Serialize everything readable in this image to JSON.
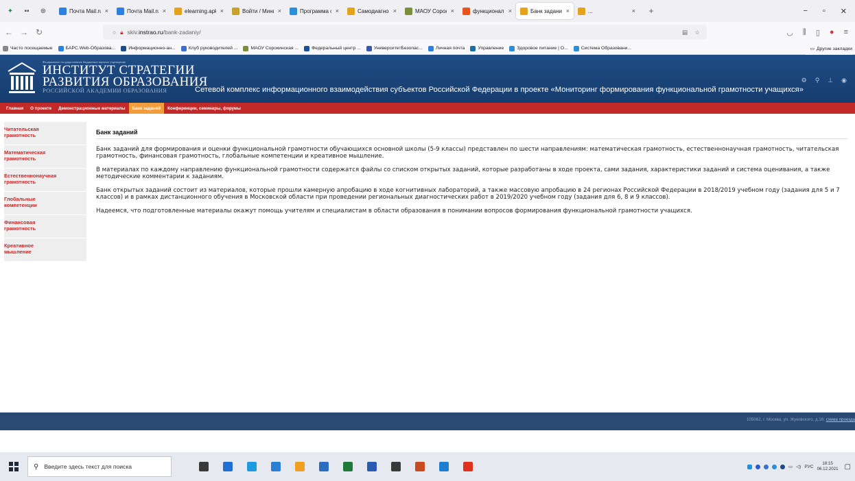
{
  "browser": {
    "tabs": [
      {
        "title": "Почта Mail.ru",
        "color": "#2d7fe0"
      },
      {
        "title": "Почта Mail.ru",
        "color": "#2d7fe0"
      },
      {
        "title": "elearning.apkpro.r",
        "color": "#e5a21b"
      },
      {
        "title": "Войти / Минпрос",
        "color": "#c8a32c"
      },
      {
        "title": "Программа онлай",
        "color": "#2a8ed8"
      },
      {
        "title": "Самодиагностика",
        "color": "#e5a21b"
      },
      {
        "title": "МАОУ Сорокинск",
        "color": "#7a8f3a"
      },
      {
        "title": "функциональная",
        "color": "#e8541e"
      },
      {
        "title": "Банк заданий",
        "color": "#e5a21b"
      },
      {
        "title": "...",
        "color": "#e5a21b"
      }
    ],
    "active_tab_index": 8,
    "url_prefix": "skiv.",
    "url_host": "instrao.ru",
    "url_path": "/bank-zadaniy/",
    "bookmarks": [
      {
        "label": "Часто посещаемые",
        "color": "#888888"
      },
      {
        "label": "БАРС.Web-Образова...",
        "color": "#2d7fe0"
      },
      {
        "label": "Информационно-ан...",
        "color": "#1d4a8a"
      },
      {
        "label": "Клуб руководителей ...",
        "color": "#3a6fd0"
      },
      {
        "label": "МАОУ Сорокинская ...",
        "color": "#7a8f3a"
      },
      {
        "label": "Федеральный центр ...",
        "color": "#1a4f9a"
      },
      {
        "label": "УниверситетБезопас...",
        "color": "#3a5aa8"
      },
      {
        "label": "Личная почта",
        "color": "#2d7fe0"
      },
      {
        "label": "Управление",
        "color": "#1b6ea8"
      },
      {
        "label": "Здоровое питание | О...",
        "color": "#2a8ed8"
      },
      {
        "label": "Система Образовани...",
        "color": "#2a8ed8"
      }
    ],
    "other_bookmarks": "Другие закладки"
  },
  "site": {
    "org_small": "Федеральное государственное бюджетное научное учреждение",
    "org_line1": "ИНСТИТУТ СТРАТЕГИИ",
    "org_line2": "РАЗВИТИЯ ОБРАЗОВАНИЯ",
    "org_line3": "РОССИЙСКОЙ АКАДЕМИИ ОБРАЗОВАНИЯ",
    "header_title": "Сетевой комплекс информационного взаимодействия субъектов Российской Федерации в проекте «Мониторинг формирования функциональной грамотности учащихся»",
    "nav": [
      {
        "label": "Главная"
      },
      {
        "label": "О проекте"
      },
      {
        "label": "Демонстрационные материалы"
      },
      {
        "label": "Банк заданий"
      },
      {
        "label": "Конференции, семинары, форумы"
      }
    ],
    "active_nav_index": 3,
    "sidebar": [
      {
        "line1": "Читательская",
        "line2": "грамотность"
      },
      {
        "line1": "Математическая",
        "line2": "грамотность"
      },
      {
        "line1": "Естественнонаучная",
        "line2": "грамотность"
      },
      {
        "line1": "Глобальные",
        "line2": "компетенции"
      },
      {
        "line1": "Финансовая",
        "line2": "грамотность"
      },
      {
        "line1": "Креативное",
        "line2": "мышление"
      }
    ],
    "page_title": "Банк заданий",
    "paragraphs": [
      "Банк заданий для формирования и оценки функциональной грамотности обучающихся основной школы (5-9 классы) представлен по шести направлениям: математическая грамотность, естественнонаучная грамотность, читательская грамотность, финансовая грамотность, глобальные компетенции и креативное мышление.",
      "В материалах по каждому направлению функциональной грамотности содержатся файлы со списком открытых заданий, которые разработаны в ходе проекта, сами задания, характеристики заданий и система оценивания, а также методические комментарии к заданиям.",
      "Банк открытых заданий состоит из материалов, которые прошли камерную апробацию в ходе когнитивных лабораторий, а также массовую апробацию в 24 регионах Российской Федерации в 2018/2019 учебном году (задания для 5 и 7 классов) и в рамках дистанционного обучения в Московской области при проведении региональных диагностических работ в 2019/2020 учебном году (задания для 6, 8 и 9 классов).",
      "Надеемся, что подготовленные материалы окажут помощь учителям и специалистам в области образования в понимании вопросов формирования функциональной грамотности учащихся."
    ],
    "footer_address": "105062, г. Москва, ул. Жуковского, д.16;",
    "footer_link": "схема проезда"
  },
  "taskbar": {
    "search_placeholder": "Введите здесь текст для поиска",
    "apps": [
      "#3a3a3a",
      "#1e6fd0",
      "#1e9be0",
      "#2a7fd4",
      "#f0a020",
      "#2a6cc0",
      "#1d7a3a",
      "#2a5bb0",
      "#3a3a3a",
      "#c84a1e",
      "#1e7fd0",
      "#e0301e"
    ],
    "lang": "РУС",
    "time": "18:15",
    "date": "06.12.2021"
  }
}
